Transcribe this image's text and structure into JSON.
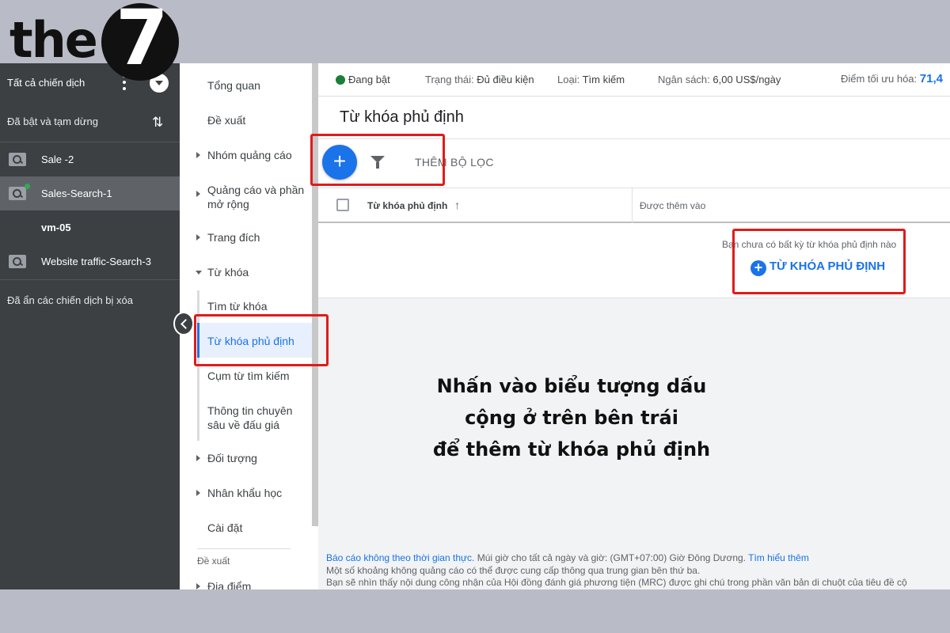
{
  "logo": {
    "text": "the",
    "mark": "7"
  },
  "campaigns": {
    "header": "Tất cả chiến dịch",
    "filter": "Đã bật và tạm dừng",
    "items": [
      {
        "name": "Sale -2",
        "icon": "search-campaign-icon",
        "active": false
      },
      {
        "name": "Sales-Search-1",
        "icon": "search-campaign-icon",
        "active": true,
        "status": "enabled"
      },
      {
        "name": "vm-05",
        "icon": "",
        "active": false
      },
      {
        "name": "Website traffic-Search-3",
        "icon": "search-campaign-icon",
        "active": false
      }
    ],
    "hidden_label": "Đã ẩn các chiến dịch bị xóa"
  },
  "nav": {
    "items": [
      {
        "label": "Tổng quan"
      },
      {
        "label": "Đề xuất"
      },
      {
        "label": "Nhóm quảng cáo"
      },
      {
        "label": "Quảng cáo và phần mở rộng"
      },
      {
        "label": "Trang đích"
      },
      {
        "label": "Từ khóa"
      },
      {
        "label": "Tìm từ khóa"
      },
      {
        "label": "Từ khóa phủ định"
      },
      {
        "label": "Cụm từ tìm kiếm"
      },
      {
        "label": "Thông tin chuyên sâu về đấu giá"
      },
      {
        "label": "Đối tượng"
      },
      {
        "label": "Nhân khẩu học"
      },
      {
        "label": "Cài đặt"
      },
      {
        "label": "Địa điểm"
      }
    ],
    "section_label": "Đề xuất",
    "active": "Từ khóa phủ định"
  },
  "status": {
    "state": "Đang bật",
    "status_label": "Trạng thái:",
    "status_value": "Đủ điều kiện",
    "type_label": "Loại:",
    "type_value": "Tìm kiếm",
    "budget_label": "Ngân sách:",
    "budget_value": "6,00 US$/ngày",
    "score_label": "Điểm tối ưu hóa:",
    "score_value": "71,4"
  },
  "page": {
    "title": "Từ khóa phủ định"
  },
  "toolbar": {
    "add_filter": "THÊM BỘ LỌC"
  },
  "table": {
    "columns": [
      "Từ khóa phủ định",
      "Được thêm vào"
    ],
    "empty_message": "Bạn chưa có bất kỳ từ khóa phủ định nào",
    "empty_button": "TỪ KHÓA PHỦ ĐỊNH"
  },
  "footer": {
    "line1_link": "Báo cáo không theo thời gian thực.",
    "line1_text": " Múi giờ cho tất cả ngày và giờ: (GMT+07:00) Giờ Đông Dương. ",
    "line1_link2": "Tìm hiểu thêm",
    "line2": "Một số khoảng không quảng cáo có thể được cung cấp thông qua trung gian bên thứ ba.",
    "line3": "Bạn sẽ nhìn thấy nội dung công nhận của Hội đồng đánh giá phương tiện (MRC) được ghi chú trong phần văn bản di chuột của tiêu đề cộ"
  },
  "instruction": {
    "line1": "Nhấn vào biểu tượng dấu",
    "line2": "cộng ở trên bên trái",
    "line3": "để thêm từ khóa phủ định"
  },
  "colors": {
    "accent": "#1a73e8",
    "highlight": "#e01b1b",
    "sidebar": "#3c4043"
  }
}
